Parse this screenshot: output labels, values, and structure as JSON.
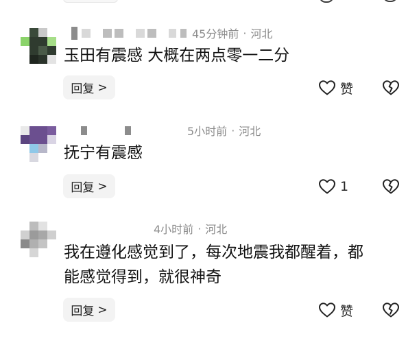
{
  "comments": [
    {
      "meta": {
        "time": "45分钟前",
        "separator": "·",
        "location": "河北"
      },
      "text": "玉田有震感 大概在两点零一二分",
      "reply_label": "回复",
      "reply_chevron": ">",
      "like_label": "赞"
    },
    {
      "meta": {
        "time": "5小时前",
        "separator": "·",
        "location": "河北"
      },
      "text": "抚宁有震感",
      "reply_label": "回复",
      "reply_chevron": ">",
      "like_label": "1"
    },
    {
      "meta": {
        "time": "4小时前",
        "separator": "·",
        "location": "河北"
      },
      "text": "我在遵化感觉到了，每次地震我都醒着，都\n能感觉得到，就很神奇",
      "reply_label": "回复",
      "reply_chevron": ">",
      "like_label": "赞"
    }
  ],
  "icons": {
    "like": "heart-outline-icon",
    "dislike": "broken-heart-icon",
    "reply_arrow": "chevron-right-icon"
  },
  "colors": {
    "meta_text": "#8c8c8c",
    "body_text": "#121212",
    "reply_button_bg": "#f3f3f3",
    "icon_stroke": "#222222",
    "avatar1_green": "#8bd36a",
    "avatar1_dark": "#2f3b2f",
    "avatar2_purple": "#6b4f8f",
    "avatar2_blue": "#8fc8e8",
    "avatar3_gray": "#9b9b9b"
  }
}
